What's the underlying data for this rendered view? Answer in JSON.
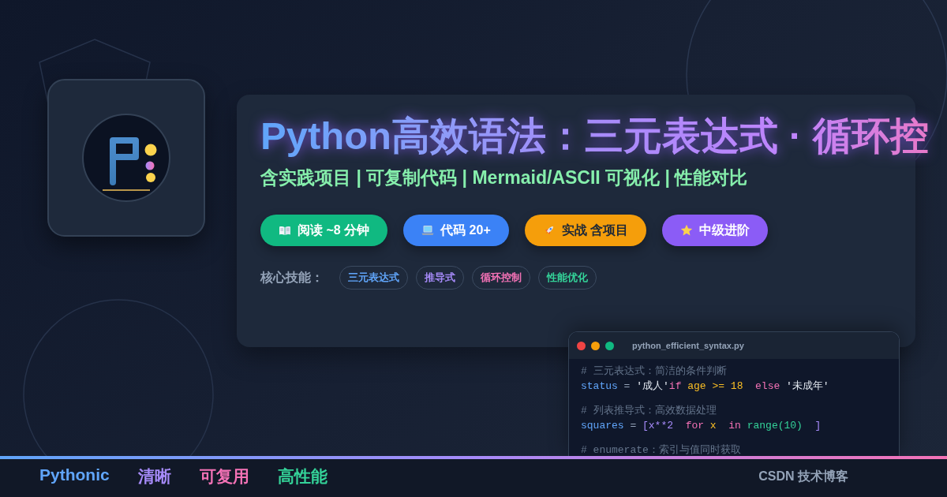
{
  "header": {
    "title": "Python高效语法：三元表达式 · 循环控",
    "subtitle": "含实践项目 | 可复制代码 | Mermaid/ASCII 可视化 | 性能对比"
  },
  "badges": [
    {
      "kind": "book",
      "label": "阅读 ~8 分钟",
      "color": "#10b981"
    },
    {
      "kind": "laptop",
      "label": "代码 20+",
      "color": "#3b82f6"
    },
    {
      "kind": "rocket",
      "label": "实战 含项目",
      "color": "#f59e0b"
    },
    {
      "kind": "star",
      "label": "中级进阶",
      "color": "#8b5cf6"
    }
  ],
  "skills": {
    "label": "核心技能：",
    "items": [
      {
        "label": "三元表达式",
        "color": "#60a5fa"
      },
      {
        "label": "推导式",
        "color": "#a78bfa"
      },
      {
        "label": "循环控制",
        "color": "#f472b6"
      },
      {
        "label": "性能优化",
        "color": "#34d399"
      }
    ]
  },
  "code_window": {
    "filename": "python_efficient_syntax.py",
    "lines": [
      {
        "kind": "comment",
        "text": "# 三元表达式：简洁的条件判断"
      },
      {
        "kind": "code",
        "tokens": [
          {
            "text": "status",
            "kind": "name"
          },
          {
            "text": " = ",
            "kind": "op"
          },
          {
            "text": "'成人'",
            "kind": "string"
          },
          {
            "text": "if",
            "kind": "keyword"
          },
          {
            "text": " age >= 18",
            "kind": "var"
          },
          {
            "text": "  else ",
            "kind": "keyword"
          },
          {
            "text": "'未成年'",
            "kind": "string"
          }
        ]
      },
      {
        "kind": "comment",
        "text": "# 列表推导式：高效数据处理"
      },
      {
        "kind": "code",
        "tokens": [
          {
            "text": "squares",
            "kind": "name"
          },
          {
            "text": " = ",
            "kind": "op"
          },
          {
            "text": "[x**2",
            "kind": "bracket"
          },
          {
            "text": "  for",
            "kind": "keyword"
          },
          {
            "text": " x",
            "kind": "var"
          },
          {
            "text": "  in",
            "kind": "keyword"
          },
          {
            "text": " range(10)",
            "kind": "call"
          },
          {
            "text": "  ]",
            "kind": "bracket"
          }
        ]
      },
      {
        "kind": "comment",
        "text": "# enumerate：索引与值同时获取"
      }
    ]
  },
  "footer": {
    "keywords": [
      {
        "label": "Pythonic",
        "color": "#60a5fa"
      },
      {
        "label": "清晰",
        "color": "#a78bfa"
      },
      {
        "label": "可复用",
        "color": "#f472b6"
      },
      {
        "label": "高性能",
        "color": "#34d399"
      }
    ],
    "brand": "CSDN 技术博客"
  }
}
